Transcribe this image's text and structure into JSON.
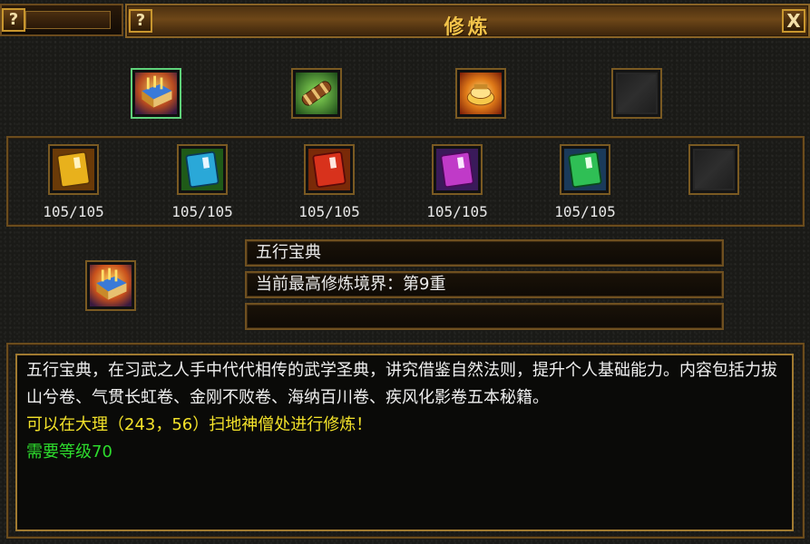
{
  "window": {
    "title": "修炼",
    "help_label": "?",
    "close_label": "X"
  },
  "top_icons": [
    {
      "icon": "golden-book-icon",
      "selected": true
    },
    {
      "icon": "scroll-bundle-icon",
      "selected": false
    },
    {
      "icon": "gold-treasure-icon",
      "selected": false
    },
    {
      "icon": "empty-slot-icon",
      "selected": false
    }
  ],
  "volumes": [
    {
      "icon": "yellow-manual-icon",
      "count": "105/105",
      "color": "#e8b11c"
    },
    {
      "icon": "blue-manual-icon",
      "count": "105/105",
      "color": "#2aa8d8"
    },
    {
      "icon": "red-manual-icon",
      "count": "105/105",
      "color": "#d8321c"
    },
    {
      "icon": "purple-manual-icon",
      "count": "105/105",
      "color": "#c03ac8"
    },
    {
      "icon": "green-manual-icon",
      "count": "105/105",
      "color": "#2fbf55"
    },
    {
      "icon": "empty-slot-icon",
      "count": "",
      "color": ""
    }
  ],
  "selected_item": {
    "icon": "golden-book-icon",
    "name": "五行宝典",
    "realm": "当前最高修炼境界：第9重",
    "extra": ""
  },
  "description": {
    "text": "五行宝典，在习武之人手中代代相传的武学圣典，讲究借鉴自然法则，提升个人基础能力。内容包括力拔山兮卷、气贯长虹卷、金刚不败卷、海纳百川卷、疾风化影卷五本秘籍。",
    "location": "可以在大理（243，56）扫地神僧处进行修炼！",
    "requirement": "需要等级70"
  },
  "colors": {
    "title": "#f2c34a",
    "location_text": "#f3e22a",
    "requirement_text": "#2ddc2d",
    "border_gold": "#a07a30"
  }
}
